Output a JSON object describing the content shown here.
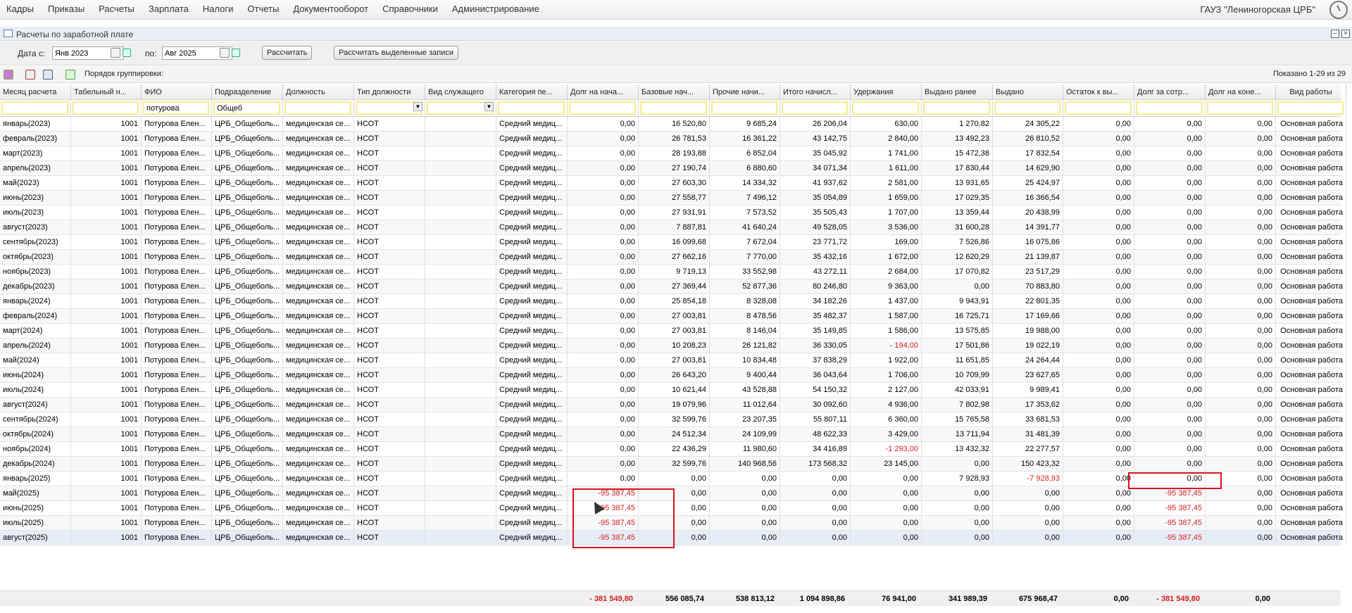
{
  "menu": [
    "Кадры",
    "Приказы",
    "Расчеты",
    "Зарплата",
    "Налоги",
    "Отчеты",
    "Документооборот",
    "Справочники",
    "Администрирование"
  ],
  "org": "ГАУЗ \"Лениногорская ЦРБ\"",
  "window_title": "Расчеты по заработной плате",
  "params": {
    "date_from_label": "Дата с:",
    "date_from": "Янв 2023",
    "date_to_label": "по:",
    "date_to": "Авг 2025",
    "calc_button": "Рассчитать",
    "calc_selected_button": "Рассчитать выделенные записи"
  },
  "toolbar": {
    "grouping_label": "Порядок группировки:",
    "shown": "Показано 1-29 из 29"
  },
  "columns": [
    "Месяц расчета",
    "Табельный н...",
    "ФИО",
    "Подразделение",
    "Должность",
    "Тип должности",
    "Вид служащего",
    "Категория пе...",
    "Долг на нача...",
    "Базовые нач...",
    "Прочие начи...",
    "Итого начисл...",
    "Удержания",
    "Выдано ранее",
    "Выдано",
    "Остаток к вы...",
    "Долг за сотр...",
    "Долг на коне...",
    "Вид работы"
  ],
  "filters": {
    "fio": "потурова",
    "dept": "Общеб"
  },
  "rows": [
    [
      "январь(2023)",
      "1001",
      "Потурова Елен...",
      "ЦРБ_Общеболь...",
      "медицинская се...",
      "НСОТ",
      "",
      "Средний медиц...",
      "0,00",
      "16 520,80",
      "9 685,24",
      "26 206,04",
      "630,00",
      "1 270,82",
      "24 305,22",
      "0,00",
      "0,00",
      "0,00",
      "Основная работа"
    ],
    [
      "февраль(2023)",
      "1001",
      "Потурова Елен...",
      "ЦРБ_Общеболь...",
      "медицинская се...",
      "НСОТ",
      "",
      "Средний медиц...",
      "0,00",
      "26 781,53",
      "16 361,22",
      "43 142,75",
      "2 840,00",
      "13 492,23",
      "26 810,52",
      "0,00",
      "0,00",
      "0,00",
      "Основная работа"
    ],
    [
      "март(2023)",
      "1001",
      "Потурова Елен...",
      "ЦРБ_Общеболь...",
      "медицинская се...",
      "НСОТ",
      "",
      "Средний медиц...",
      "0,00",
      "28 193,88",
      "6 852,04",
      "35 045,92",
      "1 741,00",
      "15 472,38",
      "17 832,54",
      "0,00",
      "0,00",
      "0,00",
      "Основная работа"
    ],
    [
      "апрель(2023)",
      "1001",
      "Потурова Елен...",
      "ЦРБ_Общеболь...",
      "медицинская се...",
      "НСОТ",
      "",
      "Средний медиц...",
      "0,00",
      "27 190,74",
      "6 880,60",
      "34 071,34",
      "1 611,00",
      "17 830,44",
      "14 629,90",
      "0,00",
      "0,00",
      "0,00",
      "Основная работа"
    ],
    [
      "май(2023)",
      "1001",
      "Потурова Елен...",
      "ЦРБ_Общеболь...",
      "медицинская се...",
      "НСОТ",
      "",
      "Средний медиц...",
      "0,00",
      "27 603,30",
      "14 334,32",
      "41 937,62",
      "2 581,00",
      "13 931,65",
      "25 424,97",
      "0,00",
      "0,00",
      "0,00",
      "Основная работа"
    ],
    [
      "июнь(2023)",
      "1001",
      "Потурова Елен...",
      "ЦРБ_Общеболь...",
      "медицинская се...",
      "НСОТ",
      "",
      "Средний медиц...",
      "0,00",
      "27 558,77",
      "7 496,12",
      "35 054,89",
      "1 659,00",
      "17 029,35",
      "16 366,54",
      "0,00",
      "0,00",
      "0,00",
      "Основная работа"
    ],
    [
      "июль(2023)",
      "1001",
      "Потурова Елен...",
      "ЦРБ_Общеболь...",
      "медицинская се...",
      "НСОТ",
      "",
      "Средний медиц...",
      "0,00",
      "27 931,91",
      "7 573,52",
      "35 505,43",
      "1 707,00",
      "13 359,44",
      "20 438,99",
      "0,00",
      "0,00",
      "0,00",
      "Основная работа"
    ],
    [
      "август(2023)",
      "1001",
      "Потурова Елен...",
      "ЦРБ_Общеболь...",
      "медицинская се...",
      "НСОТ",
      "",
      "Средний медиц...",
      "0,00",
      "7 887,81",
      "41 640,24",
      "49 528,05",
      "3 536,00",
      "31 600,28",
      "14 391,77",
      "0,00",
      "0,00",
      "0,00",
      "Основная работа"
    ],
    [
      "сентябрь(2023)",
      "1001",
      "Потурова Елен...",
      "ЦРБ_Общеболь...",
      "медицинская се...",
      "НСОТ",
      "",
      "Средний медиц...",
      "0,00",
      "16 099,68",
      "7 672,04",
      "23 771,72",
      "169,00",
      "7 526,86",
      "16 075,86",
      "0,00",
      "0,00",
      "0,00",
      "Основная работа"
    ],
    [
      "октябрь(2023)",
      "1001",
      "Потурова Елен...",
      "ЦРБ_Общеболь...",
      "медицинская се...",
      "НСОТ",
      "",
      "Средний медиц...",
      "0,00",
      "27 662,16",
      "7 770,00",
      "35 432,16",
      "1 672,00",
      "12 620,29",
      "21 139,87",
      "0,00",
      "0,00",
      "0,00",
      "Основная работа"
    ],
    [
      "ноябрь(2023)",
      "1001",
      "Потурова Елен...",
      "ЦРБ_Общеболь...",
      "медицинская се...",
      "НСОТ",
      "",
      "Средний медиц...",
      "0,00",
      "9 719,13",
      "33 552,98",
      "43 272,11",
      "2 684,00",
      "17 070,82",
      "23 517,29",
      "0,00",
      "0,00",
      "0,00",
      "Основная работа"
    ],
    [
      "декабрь(2023)",
      "1001",
      "Потурова Елен...",
      "ЦРБ_Общеболь...",
      "медицинская се...",
      "НСОТ",
      "",
      "Средний медиц...",
      "0,00",
      "27 369,44",
      "52 877,36",
      "80 246,80",
      "9 363,00",
      "0,00",
      "70 883,80",
      "0,00",
      "0,00",
      "0,00",
      "Основная работа"
    ],
    [
      "январь(2024)",
      "1001",
      "Потурова Елен...",
      "ЦРБ_Общеболь...",
      "медицинская се...",
      "НСОТ",
      "",
      "Средний медиц...",
      "0,00",
      "25 854,18",
      "8 328,08",
      "34 182,26",
      "1 437,00",
      "9 943,91",
      "22 801,35",
      "0,00",
      "0,00",
      "0,00",
      "Основная работа"
    ],
    [
      "февраль(2024)",
      "1001",
      "Потурова Елен...",
      "ЦРБ_Общеболь...",
      "медицинская се...",
      "НСОТ",
      "",
      "Средний медиц...",
      "0,00",
      "27 003,81",
      "8 478,56",
      "35 482,37",
      "1 587,00",
      "16 725,71",
      "17 169,66",
      "0,00",
      "0,00",
      "0,00",
      "Основная работа"
    ],
    [
      "март(2024)",
      "1001",
      "Потурова Елен...",
      "ЦРБ_Общеболь...",
      "медицинская се...",
      "НСОТ",
      "",
      "Средний медиц...",
      "0,00",
      "27 003,81",
      "8 146,04",
      "35 149,85",
      "1 586,00",
      "13 575,85",
      "19 988,00",
      "0,00",
      "0,00",
      "0,00",
      "Основная работа"
    ],
    [
      "апрель(2024)",
      "1001",
      "Потурова Елен...",
      "ЦРБ_Общеболь...",
      "медицинская се...",
      "НСОТ",
      "",
      "Средний медиц...",
      "0,00",
      "10 208,23",
      "26 121,82",
      "36 330,05",
      "- 194,00",
      "17 501,86",
      "19 022,19",
      "0,00",
      "0,00",
      "0,00",
      "Основная работа"
    ],
    [
      "май(2024)",
      "1001",
      "Потурова Елен...",
      "ЦРБ_Общеболь...",
      "медицинская се...",
      "НСОТ",
      "",
      "Средний медиц...",
      "0,00",
      "27 003,81",
      "10 834,48",
      "37 838,29",
      "1 922,00",
      "11 651,85",
      "24 264,44",
      "0,00",
      "0,00",
      "0,00",
      "Основная работа"
    ],
    [
      "июнь(2024)",
      "1001",
      "Потурова Елен...",
      "ЦРБ_Общеболь...",
      "медицинская се...",
      "НСОТ",
      "",
      "Средний медиц...",
      "0,00",
      "26 643,20",
      "9 400,44",
      "36 043,64",
      "1 706,00",
      "10 709,99",
      "23 627,65",
      "0,00",
      "0,00",
      "0,00",
      "Основная работа"
    ],
    [
      "июль(2024)",
      "1001",
      "Потурова Елен...",
      "ЦРБ_Общеболь...",
      "медицинская се...",
      "НСОТ",
      "",
      "Средний медиц...",
      "0,00",
      "10 621,44",
      "43 528,88",
      "54 150,32",
      "2 127,00",
      "42 033,91",
      "9 989,41",
      "0,00",
      "0,00",
      "0,00",
      "Основная работа"
    ],
    [
      "август(2024)",
      "1001",
      "Потурова Елен...",
      "ЦРБ_Общеболь...",
      "медицинская се...",
      "НСОТ",
      "",
      "Средний медиц...",
      "0,00",
      "19 079,96",
      "11 012,64",
      "30 092,60",
      "4 936,00",
      "7 802,98",
      "17 353,62",
      "0,00",
      "0,00",
      "0,00",
      "Основная работа"
    ],
    [
      "сентябрь(2024)",
      "1001",
      "Потурова Елен...",
      "ЦРБ_Общеболь...",
      "медицинская се...",
      "НСОТ",
      "",
      "Средний медиц...",
      "0,00",
      "32 599,76",
      "23 207,35",
      "55 807,11",
      "6 360,00",
      "15 765,58",
      "33 681,53",
      "0,00",
      "0,00",
      "0,00",
      "Основная работа"
    ],
    [
      "октябрь(2024)",
      "1001",
      "Потурова Елен...",
      "ЦРБ_Общеболь...",
      "медицинская се...",
      "НСОТ",
      "",
      "Средний медиц...",
      "0,00",
      "24 512,34",
      "24 109,99",
      "48 622,33",
      "3 429,00",
      "13 711,94",
      "31 481,39",
      "0,00",
      "0,00",
      "0,00",
      "Основная работа"
    ],
    [
      "ноябрь(2024)",
      "1001",
      "Потурова Елен...",
      "ЦРБ_Общеболь...",
      "медицинская се...",
      "НСОТ",
      "",
      "Средний медиц...",
      "0,00",
      "22 436,29",
      "11 980,60",
      "34 416,89",
      "-1 293,00",
      "13 432,32",
      "22 277,57",
      "0,00",
      "0,00",
      "0,00",
      "Основная работа"
    ],
    [
      "декабрь(2024)",
      "1001",
      "Потурова Елен...",
      "ЦРБ_Общеболь...",
      "медицинская се...",
      "НСОТ",
      "",
      "Средний медиц...",
      "0,00",
      "32 599,76",
      "140 968,56",
      "173 568,32",
      "23 145,00",
      "0,00",
      "150 423,32",
      "0,00",
      "0,00",
      "0,00",
      "Основная работа"
    ],
    [
      "январь(2025)",
      "1001",
      "Потурова Елен...",
      "ЦРБ_Общеболь...",
      "медицинская се...",
      "НСОТ",
      "",
      "Средний медиц...",
      "0,00",
      "0,00",
      "0,00",
      "0,00",
      "0,00",
      "7 928,93",
      "-7 928,93",
      "0,00",
      "0,00",
      "0,00",
      "Основная работа"
    ],
    [
      "май(2025)",
      "1001",
      "Потурова Елен...",
      "ЦРБ_Общеболь...",
      "медицинская се...",
      "НСОТ",
      "",
      "Средний медиц...",
      "-95 387,45",
      "0,00",
      "0,00",
      "0,00",
      "0,00",
      "0,00",
      "0,00",
      "0,00",
      "-95 387,45",
      "0,00",
      "Основная работа"
    ],
    [
      "июнь(2025)",
      "1001",
      "Потурова Елен...",
      "ЦРБ_Общеболь...",
      "медицинская се...",
      "НСОТ",
      "",
      "Средний медиц...",
      "-95 387,45",
      "0,00",
      "0,00",
      "0,00",
      "0,00",
      "0,00",
      "0,00",
      "0,00",
      "-95 387,45",
      "0,00",
      "Основная работа"
    ],
    [
      "июль(2025)",
      "1001",
      "Потурова Елен...",
      "ЦРБ_Общеболь...",
      "медицинская се...",
      "НСОТ",
      "",
      "Средний медиц...",
      "-95 387,45",
      "0,00",
      "0,00",
      "0,00",
      "0,00",
      "0,00",
      "0,00",
      "0,00",
      "-95 387,45",
      "0,00",
      "Основная работа"
    ],
    [
      "август(2025)",
      "1001",
      "Потурова Елен...",
      "ЦРБ_Общеболь...",
      "медицинская се...",
      "НСОТ",
      "",
      "Средний медиц...",
      "-95 387,45",
      "0,00",
      "0,00",
      "0,00",
      "0,00",
      "0,00",
      "0,00",
      "0,00",
      "-95 387,45",
      "0,00",
      "Основная работа"
    ]
  ],
  "totals": [
    "",
    "",
    "",
    "",
    "",
    "",
    "",
    "",
    "- 381 549,80",
    "556 085,74",
    "538 813,12",
    "1 094 898,86",
    "76 941,00",
    "341 989,39",
    "675 968,47",
    "0,00",
    "- 381 549,80",
    "0,00",
    ""
  ],
  "colors": {
    "negative": "#d42020",
    "highlight_box": "#d7131d",
    "filter_border": "#f3ee8a"
  }
}
